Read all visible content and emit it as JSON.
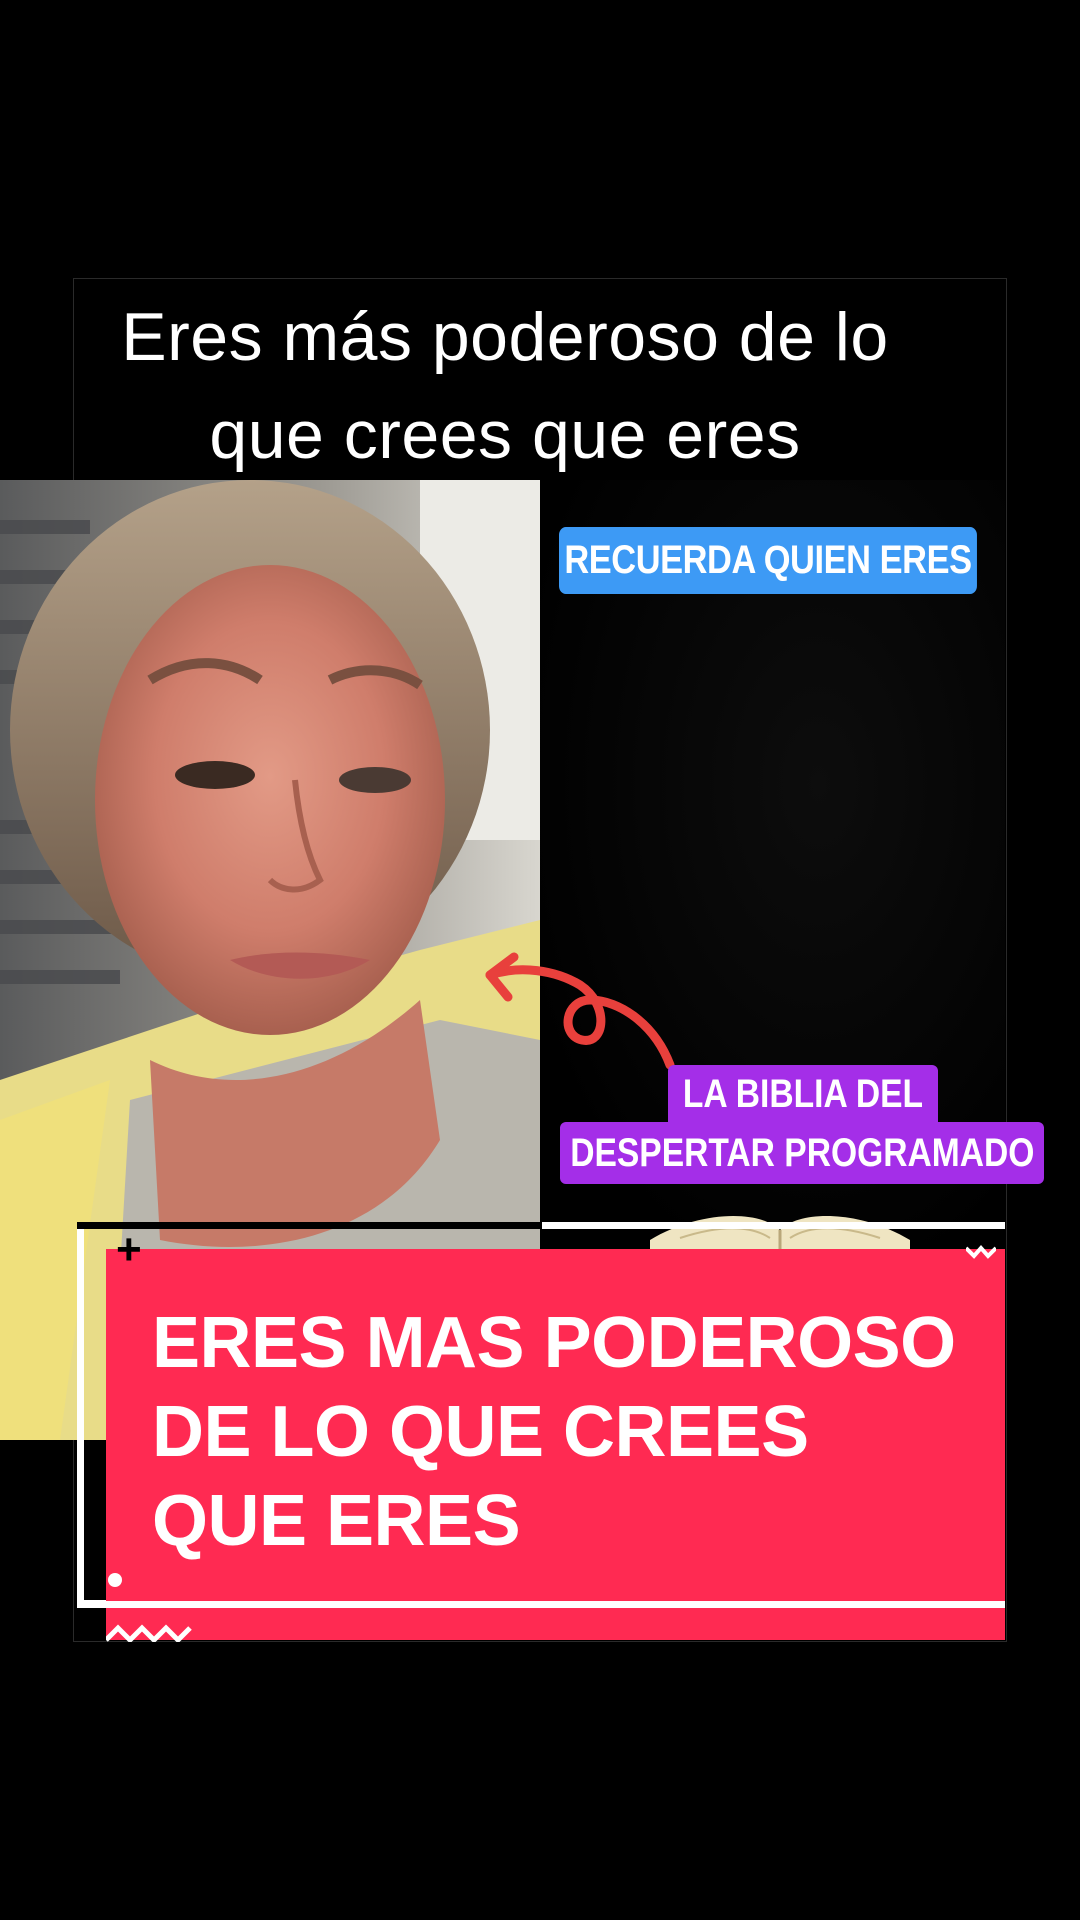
{
  "top_caption": {
    "line1": "Eres más poderoso de lo",
    "line2": "que crees que eres"
  },
  "tags": {
    "blue": "RECUERDA QUIEN ERES",
    "purple_line1": "LA BIBLIA DEL",
    "purple_line2": "DESPERTAR PROGRAMADO"
  },
  "card": {
    "text": "ERES MAS PODEROSO DE LO QUE CREES QUE ERES",
    "plus_symbol": "+"
  },
  "colors": {
    "background": "#000000",
    "card_pink": "#ff2a52",
    "tag_blue": "#3d9af5",
    "tag_purple": "#a42ee8",
    "arrow_red": "#e8403c"
  },
  "icons": {
    "arrow": "curly-arrow-icon",
    "book": "open-book-icon"
  }
}
